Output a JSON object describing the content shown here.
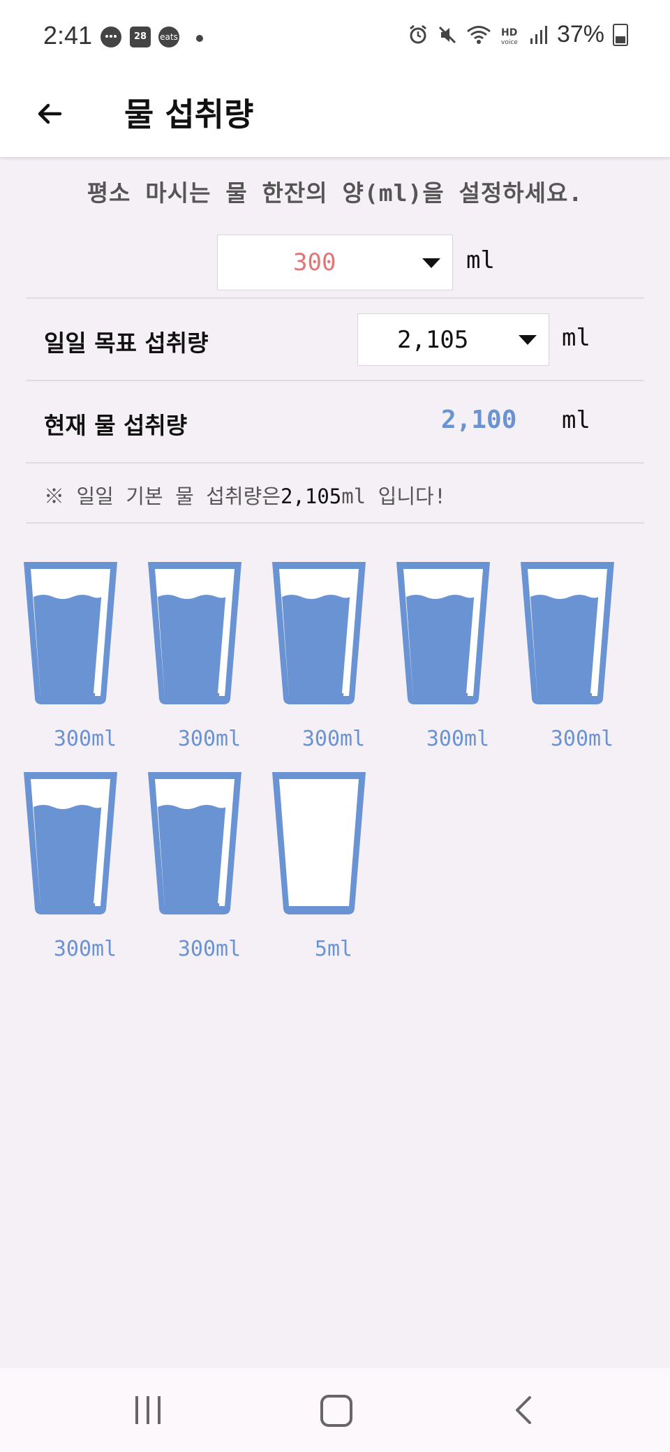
{
  "status_bar": {
    "time": "2:41",
    "notification_icons": [
      "chat-bubble-icon",
      "calendar-28-icon",
      "coupang-eats-icon"
    ],
    "calendar_day": "28",
    "eats_label": "eats",
    "battery": "37%",
    "right_icons": [
      "alarm-icon",
      "mute-icon",
      "wifi-icon",
      "hd-voice-icon",
      "signal-icon",
      "battery-icon"
    ]
  },
  "app_bar": {
    "title": "물 섭취량",
    "back_icon": "arrow-left-icon"
  },
  "instruction": "평소 마시는 물 한잔의 양(ml)을 설정하세요.",
  "cup_size": {
    "value": "300",
    "unit": "ml"
  },
  "daily_goal": {
    "label": "일일 목표 섭취량",
    "value": "2,105",
    "unit": "ml"
  },
  "current_intake": {
    "label": "현재 물 섭취량",
    "value": "2,100",
    "unit": "ml"
  },
  "note": {
    "prefix": "※ 일일 기본 물 섭취량은",
    "amount": "2,105",
    "suffix": "ml 입니다!"
  },
  "cups": [
    {
      "label": "300ml",
      "filled": true
    },
    {
      "label": "300ml",
      "filled": true
    },
    {
      "label": "300ml",
      "filled": true
    },
    {
      "label": "300ml",
      "filled": true
    },
    {
      "label": "300ml",
      "filled": true
    },
    {
      "label": "300ml",
      "filled": true
    },
    {
      "label": "300ml",
      "filled": true
    },
    {
      "label": "5ml",
      "filled": false
    }
  ],
  "colors": {
    "accent_blue": "#6a93d4",
    "cup_value_red": "#e07575",
    "background": "#f5f0f5"
  },
  "nav_bar": {
    "icons": [
      "recent-apps-icon",
      "home-icon",
      "back-icon"
    ]
  }
}
